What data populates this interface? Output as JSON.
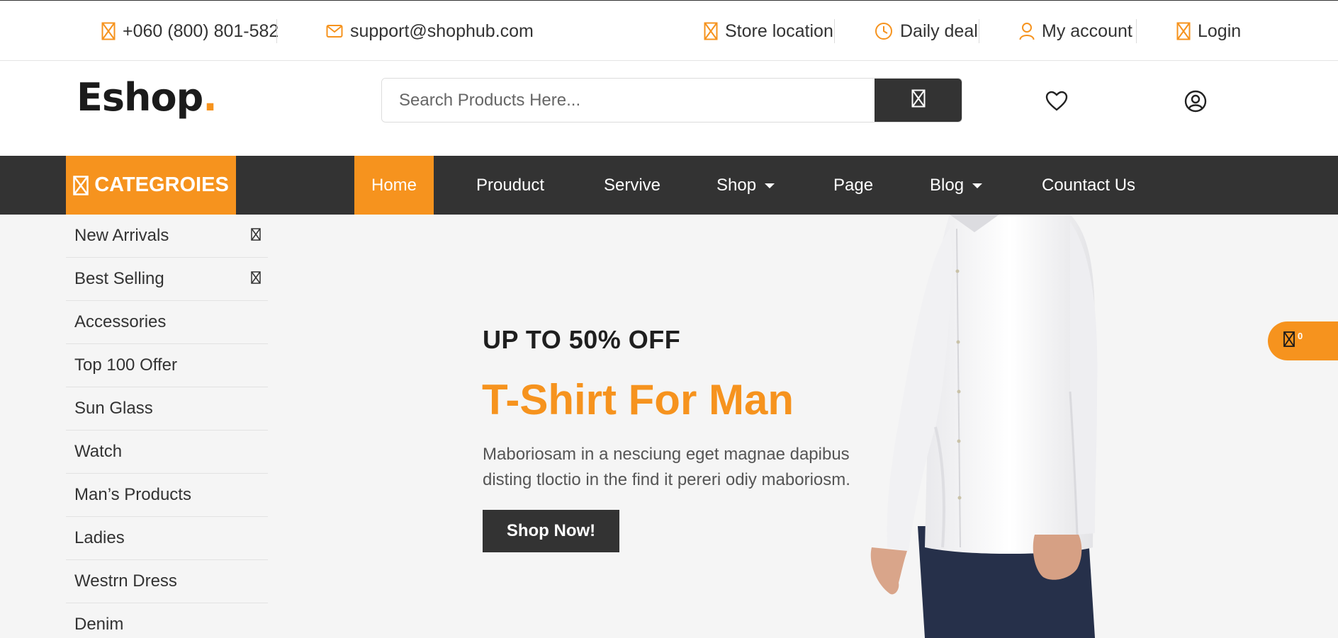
{
  "topbar": {
    "phone": "+060 (800) 801-582",
    "email": "support@shophub.com",
    "store_location": "Store location",
    "daily_deal": "Daily deal",
    "my_account": "My account",
    "login": "Login"
  },
  "header": {
    "logo_text": "Eshop",
    "logo_dot": ".",
    "search_placeholder": "Search Products Here..."
  },
  "nav": {
    "categories_label": "CATEGROIES",
    "items": [
      {
        "label": "Home",
        "active": true
      },
      {
        "label": "Prouduct"
      },
      {
        "label": "Servive"
      },
      {
        "label": "Shop",
        "dropdown": true
      },
      {
        "label": "Page"
      },
      {
        "label": "Blog",
        "dropdown": true
      },
      {
        "label": "Countact Us"
      }
    ]
  },
  "sidebar": {
    "items": [
      {
        "label": "New Arrivals",
        "has_submenu": true
      },
      {
        "label": "Best Selling",
        "has_submenu": true
      },
      {
        "label": "Accessories"
      },
      {
        "label": "Top 100 Offer"
      },
      {
        "label": "Sun Glass"
      },
      {
        "label": "Watch"
      },
      {
        "label": "Man’s Products"
      },
      {
        "label": "Ladies"
      },
      {
        "label": "Westrn Dress"
      },
      {
        "label": "Denim"
      }
    ]
  },
  "hero": {
    "small_title": "UP TO 50% OFF",
    "title": "T-Shirt For Man",
    "description": "Maboriosam in a nesciung eget magnae dapibus disting tloctio in the find it pereri odiy maboriosm.",
    "cta": "Shop Now!"
  },
  "cart": {
    "count": "0"
  },
  "colors": {
    "accent": "#f6931e",
    "dark": "#333333",
    "hero_bg": "#f5f5f5"
  }
}
